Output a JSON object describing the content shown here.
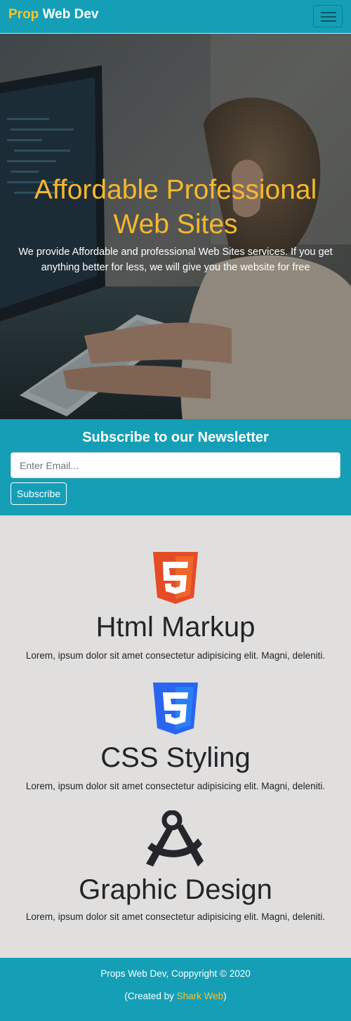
{
  "navbar": {
    "brand_accent": "Prop",
    "brand_rest": "Web Dev",
    "toggler_icon": "hamburger-icon"
  },
  "hero": {
    "title": "Affordable Professional Web Sites",
    "text": "We provide Affordable and professional Web Sites services. If you get anything better for less, we will give you the website for free"
  },
  "newsletter": {
    "title": "Subscribe to our Newsletter",
    "email_placeholder": "Enter Email...",
    "button_label": "Subscribe"
  },
  "features": [
    {
      "icon": "html5-icon",
      "title": "Html Markup",
      "text": "Lorem, ipsum dolor sit amet consectetur adipisicing elit. Magni, deleniti."
    },
    {
      "icon": "css3-icon",
      "title": "CSS Styling",
      "text": "Lorem, ipsum dolor sit amet consectetur adipisicing elit. Magni, deleniti."
    },
    {
      "icon": "compass-drafting-icon",
      "title": "Graphic Design",
      "text": "Lorem, ipsum dolor sit amet consectetur adipisicing elit. Magni, deleniti."
    }
  ],
  "footer": {
    "copyright": "Props Web Dev, Coppyright © 2020",
    "created_prefix": "(Created by ",
    "created_link": "Shark Web",
    "created_suffix": ")"
  },
  "colors": {
    "primary": "#149fb6",
    "accent": "#f4c430",
    "hero_title": "#f5b82e",
    "html5": "#e34c26",
    "css3": "#2965f1",
    "background": "#e0dfde"
  }
}
